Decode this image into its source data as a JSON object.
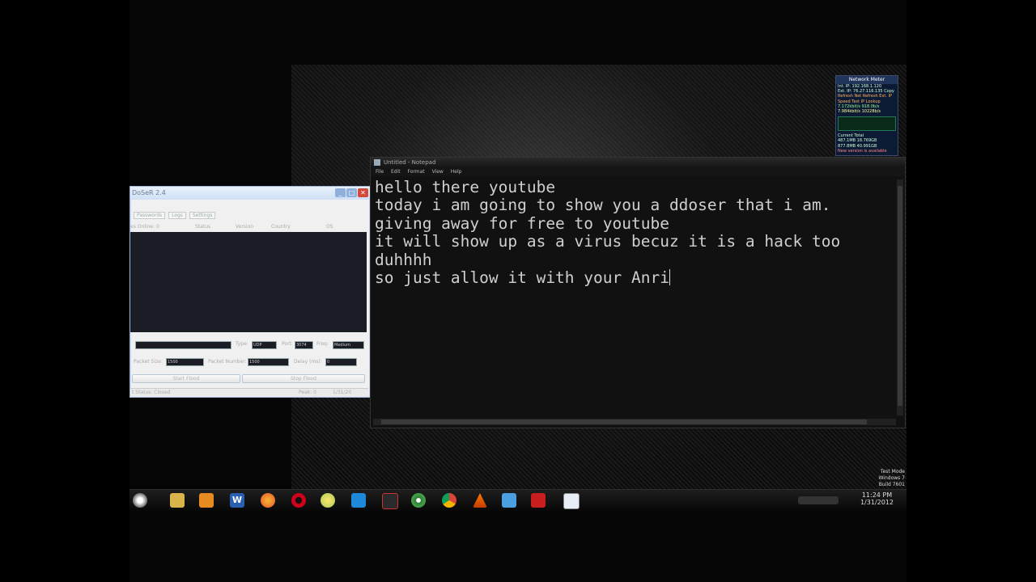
{
  "ddoser": {
    "title": "DoSeR 2.4",
    "tabs": [
      "Passwords",
      "Logs",
      "Settings"
    ],
    "header": [
      "es Online: 0",
      "Status",
      "Version",
      "Country",
      "OS"
    ],
    "type_label": "Type:",
    "type_value": "UDP",
    "port_label": "Port:",
    "port_value": "3074",
    "freq_label": "Freq:",
    "freq_value": "Medium",
    "packet_size_label": "Packet Size:",
    "packet_size_value": "1500",
    "packet_number_label": "Packet Number:",
    "packet_number_value": "1500",
    "delay_label": "Delay (ms):",
    "delay_value": "0",
    "start_label": "Start Flood",
    "stop_label": "Stop Flood",
    "status_text": "t Status: Closed",
    "status_right": "Peak: 0",
    "status_date": "1/31/20"
  },
  "notepad": {
    "title": "Untitled - Notepad",
    "menu": [
      "File",
      "Edit",
      "Format",
      "View",
      "Help"
    ],
    "lines": [
      "hello there youtube",
      "today i am going to show you a ddoser that i am.",
      "giving away for free to youtube",
      "it will show up as a virus becuz it is a hack too",
      "duhhhh",
      "so just allow it with your Anri"
    ]
  },
  "gadget": {
    "title": "Network Meter",
    "lines": [
      "Int. IP: 192.168.1.120",
      "Ext. IP: 76.27.116.135   Copy",
      "Refresh Net   Refresh Ext. IP",
      "Speed Test    IP Lookup",
      "7.172kbit/s   918.0b/s",
      "7.984kbit/s   10228b/s",
      "Current   Total",
      "487.1MB   18.769GB",
      "877.8MB   40.991GB",
      "New version is available"
    ]
  },
  "os": {
    "watermark": [
      "Test Mode",
      "Windows 7",
      "Build 7601"
    ],
    "time": "11:24 PM",
    "date": "1/31/2012"
  },
  "colors": {
    "background": "#000000",
    "notepad_bg": "#111111",
    "notepad_text": "#cfcfcf"
  }
}
